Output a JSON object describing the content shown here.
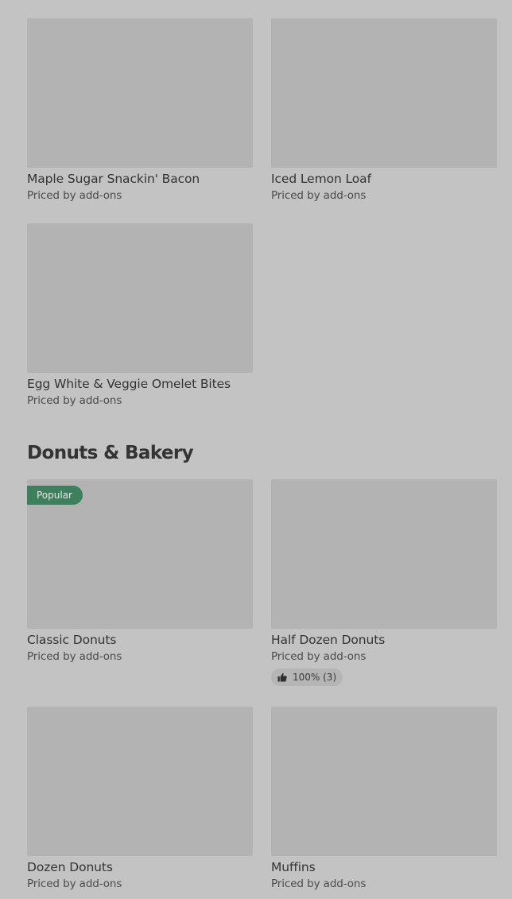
{
  "sections": [
    {
      "items": [
        {
          "name": "Maple Sugar Snackin' Bacon",
          "price": "Priced by add-ons"
        },
        {
          "name": "Iced Lemon Loaf",
          "price": "Priced by add-ons"
        },
        {
          "name": "Egg White & Veggie Omelet Bites",
          "price": "Priced by add-ons"
        }
      ]
    },
    {
      "title": "Donuts & Bakery",
      "items": [
        {
          "name": "Classic Donuts",
          "price": "Priced by add-ons",
          "badge": "Popular"
        },
        {
          "name": "Half Dozen Donuts",
          "price": "Priced by add-ons",
          "rating": {
            "icon": "thumbs-up-icon",
            "text": "100% (3)"
          }
        },
        {
          "name": "Dozen Donuts",
          "price": "Priced by add-ons"
        },
        {
          "name": "Muffins",
          "price": "Priced by add-ons"
        }
      ]
    }
  ],
  "colors": {
    "background": "#c3c3c3",
    "image_placeholder": "#b3b3b3",
    "badge_background": "#3e7f5e",
    "text_primary": "#333333",
    "text_secondary": "#4b4b4b"
  }
}
